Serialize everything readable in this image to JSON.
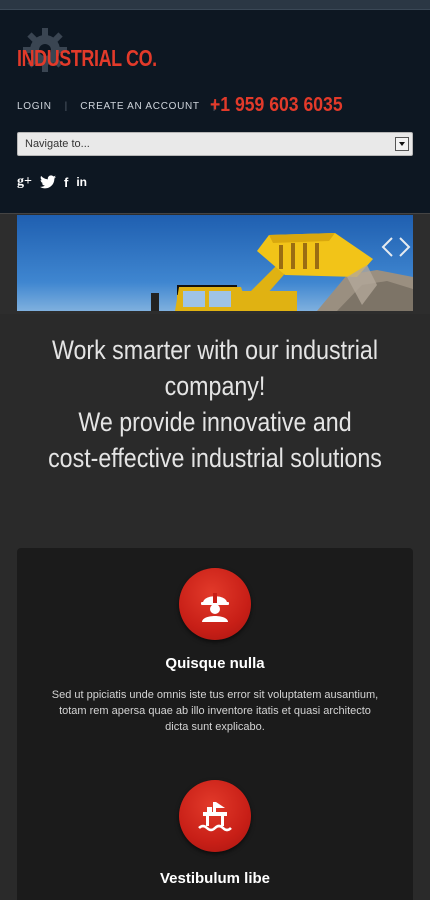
{
  "header": {
    "logo_text": "INDUSTRIAL CO.",
    "links": [
      "LOGIN",
      "CREATE AN ACCOUNT"
    ],
    "phone": "+1 959 603 6035"
  },
  "nav": {
    "selected": "Navigate to..."
  },
  "social": {
    "items": [
      "google-plus-icon",
      "twitter-icon",
      "facebook-icon",
      "linkedin-icon"
    ],
    "gplus_glyph": "g+",
    "fb_glyph": "f",
    "in_glyph": "in"
  },
  "tagline": {
    "lines": [
      "Work smarter with our industrial",
      "company!",
      "We provide innovative and",
      "cost-effective industrial solutions"
    ]
  },
  "features": [
    {
      "icon": "construction-worker-icon",
      "title": "Quisque nulla",
      "text_lines": [
        "Sed ut ppiciatis unde omnis iste tus error sit voluptatem ausantium,",
        "totam rem apersa quae ab illo inventore itatis et quasi architecto",
        "dicta sunt explicabo."
      ]
    },
    {
      "icon": "oil-platform-icon",
      "title": "Vestibulum libe"
    }
  ],
  "colors": {
    "accent": "#e23a2a",
    "header_bg": "#0d1722",
    "body_bg": "#2a2a2a",
    "panel_bg": "#1b1b1b"
  }
}
